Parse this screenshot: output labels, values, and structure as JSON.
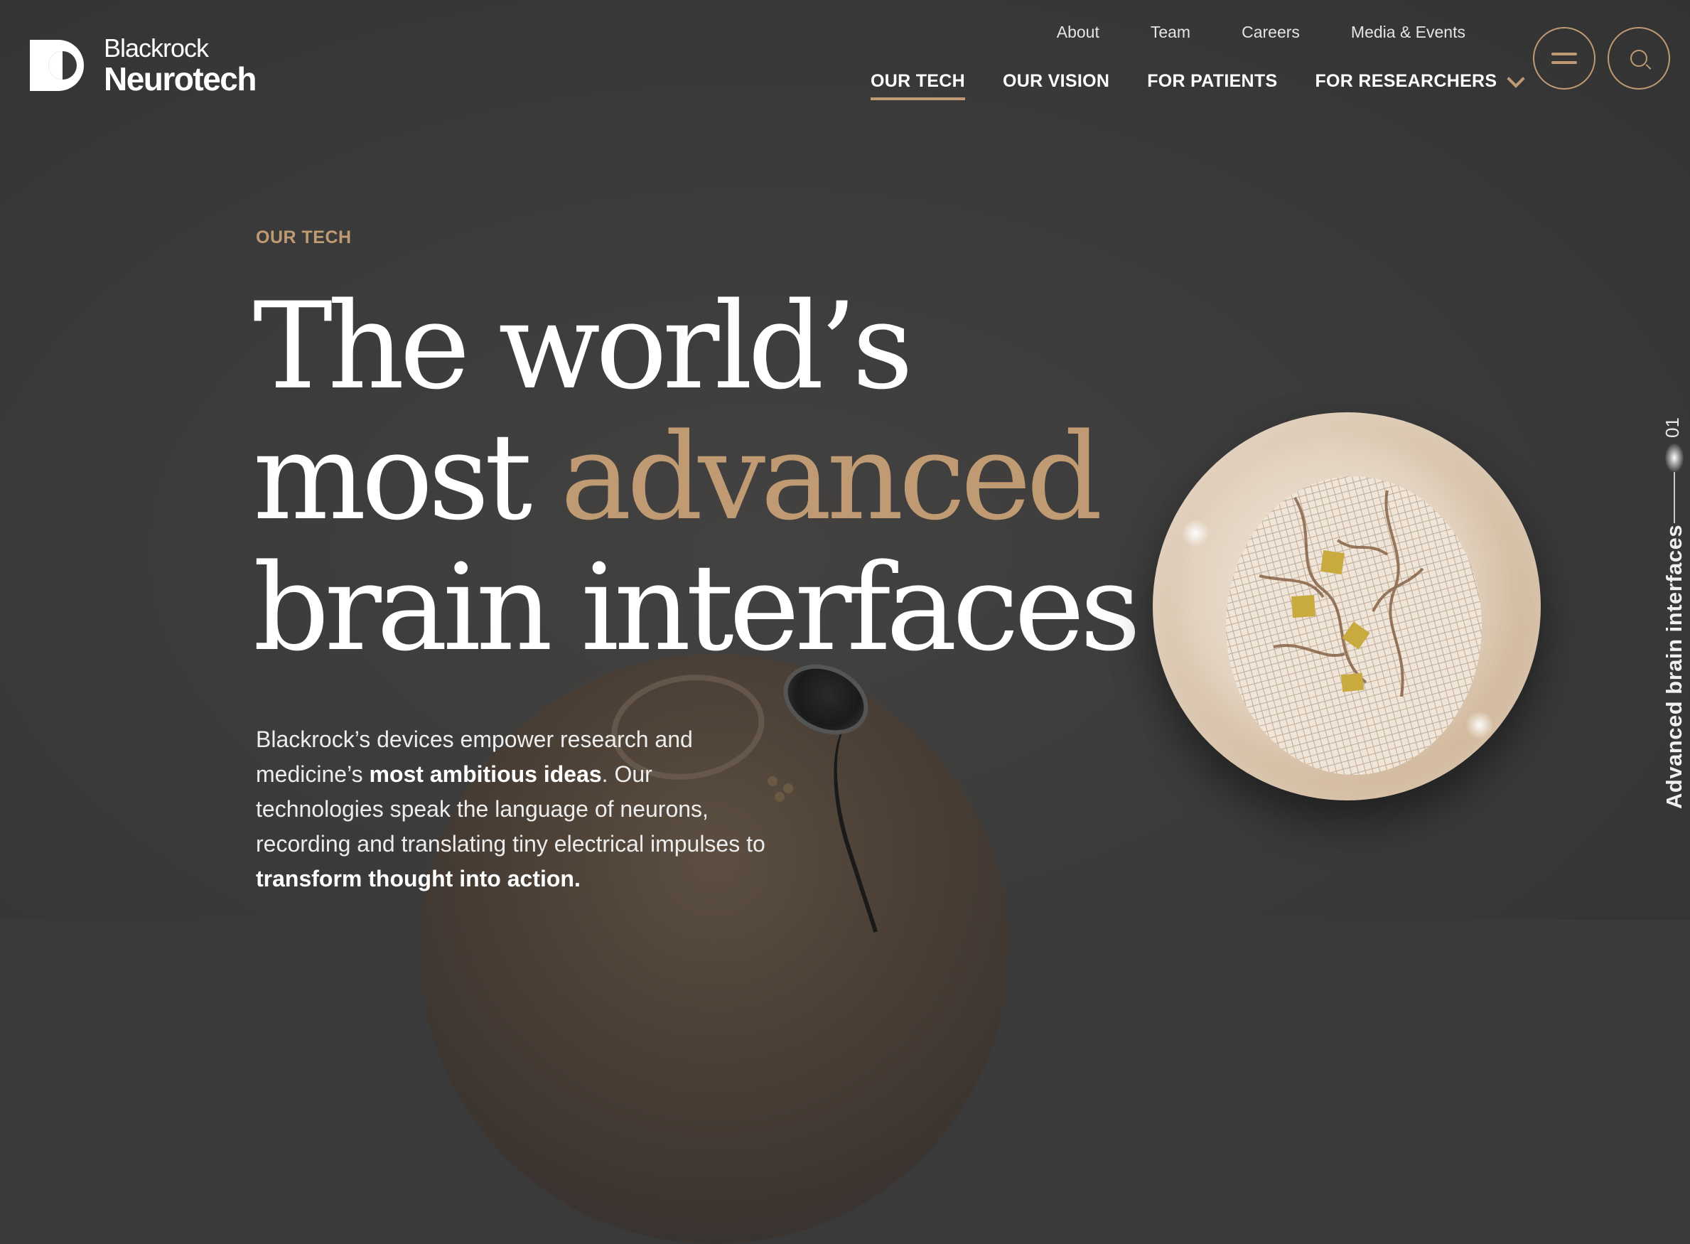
{
  "brand": {
    "line1": "Blackrock",
    "line2": "Neurotech"
  },
  "top_nav": [
    "About",
    "Team",
    "Careers",
    "Media & Events"
  ],
  "main_nav": [
    {
      "label": "OUR TECH",
      "active": true
    },
    {
      "label": "OUR VISION",
      "active": false
    },
    {
      "label": "FOR PATIENTS",
      "active": false
    },
    {
      "label": "FOR RESEARCHERS",
      "active": false,
      "dropdown": true
    }
  ],
  "icons": {
    "menu": "hamburger-icon",
    "search": "search-icon",
    "dropdown": "chevron-down-icon"
  },
  "hero": {
    "eyebrow": "OUR TECH",
    "headline_pre": "The world’s most ",
    "headline_accent": "advanced",
    "headline_post": " brain interfaces",
    "body": {
      "p1": "Blackrock’s devices empower research and medicine’s ",
      "b1": "most ambitious ideas",
      "p2": ". Our technologies speak the language of neurons, recording and translating tiny electrical impulses to ",
      "b2": "transform thought into action."
    }
  },
  "slide_indicator": {
    "number": "01",
    "label": "Advanced brain interfaces"
  },
  "colors": {
    "accent": "#c09a72",
    "background": "#3a3a3a",
    "text": "#ffffff"
  }
}
